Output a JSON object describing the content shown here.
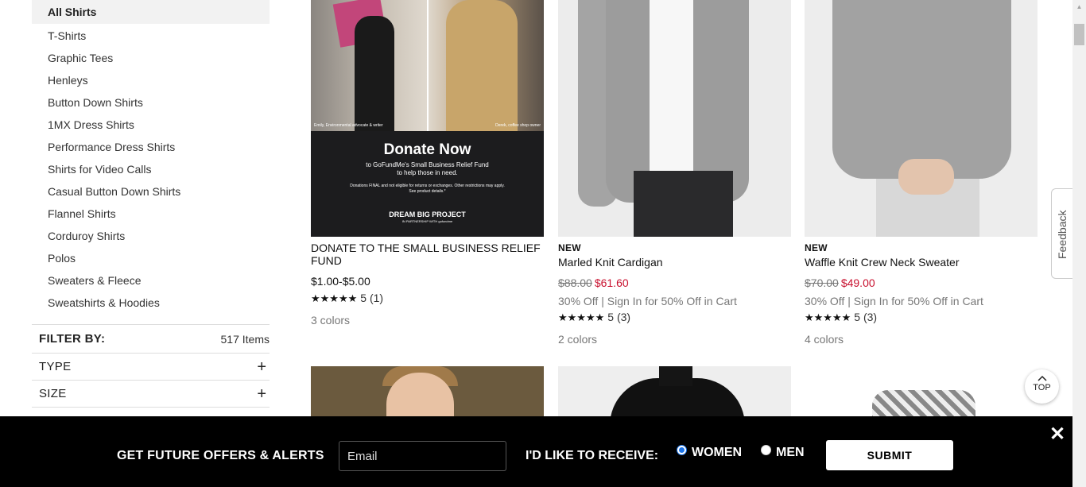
{
  "sidebar": {
    "categories": [
      "All Shirts",
      "T-Shirts",
      "Graphic Tees",
      "Henleys",
      "Button Down Shirts",
      "1MX Dress Shirts",
      "Performance Dress Shirts",
      "Shirts for Video Calls",
      "Casual Button Down Shirts",
      "Flannel Shirts",
      "Corduroy Shirts",
      "Polos",
      "Sweaters & Fleece",
      "Sweatshirts & Hoodies"
    ],
    "active_category": "All Shirts",
    "filter_label": "FILTER BY:",
    "item_count": "517 Items",
    "facets": [
      {
        "label": "TYPE",
        "icon": "plus-icon",
        "symbol": "+"
      },
      {
        "label": "SIZE",
        "icon": "plus-icon",
        "symbol": "+"
      }
    ]
  },
  "products": [
    {
      "name": "DONATE TO THE SMALL BUSINESS RELIEF FUND",
      "price": "$1.00-$5.00",
      "stars": "★★★★★",
      "rating": "5 (1)",
      "colors": "3 colors",
      "image": {
        "caption_left": "Emily, Environmental advocate & writer",
        "caption_right": "Derek, coffee shop owner",
        "title": "Donate Now",
        "subtitle_1": "to GoFundMe's Small Business Relief Fund",
        "subtitle_2": "to help those in need.",
        "fine_1": "Donations FINAL and not eligible for returns or exchanges. Other restrictions may apply.",
        "fine_2": "See product details.*",
        "brand": "DREAM BIG PROJECT",
        "partner": "IN PARTNERSHIP WITH gofundme"
      }
    },
    {
      "badge": "NEW",
      "name": "Marled Knit Cardigan",
      "original_price": "$88.00",
      "sale_price": "$61.60",
      "promo": "30% Off | Sign In for 50% Off in Cart",
      "stars": "★★★★★",
      "rating": "5 (3)",
      "colors": "2 colors"
    },
    {
      "badge": "NEW",
      "name": "Waffle Knit Crew Neck Sweater",
      "original_price": "$70.00",
      "sale_price": "$49.00",
      "promo": "30% Off | Sign In for 50% Off in Cart",
      "stars": "★★★★★",
      "rating": "5 (3)",
      "colors": "4 colors"
    }
  ],
  "feedback_tab": {
    "label": "Feedback",
    "icon": "feedback-icon"
  },
  "top_button": {
    "label": "TOP",
    "icon": "chevron-up-icon"
  },
  "scrollbar": {
    "up_icon": "▲"
  },
  "banner": {
    "headline": "GET FUTURE OFFERS & ALERTS",
    "email_placeholder": "Email",
    "receive_label": "I'D LIKE TO RECEIVE:",
    "options": [
      {
        "label": "WOMEN",
        "selected": true
      },
      {
        "label": "MEN",
        "selected": false
      }
    ],
    "submit_label": "SUBMIT",
    "close_symbol": "✕",
    "colors": {
      "background": "#000000",
      "text": "#ffffff"
    }
  },
  "colors": {
    "sale": "#c8102e",
    "muted": "#777777",
    "radio_accent": "#1a73e8"
  }
}
